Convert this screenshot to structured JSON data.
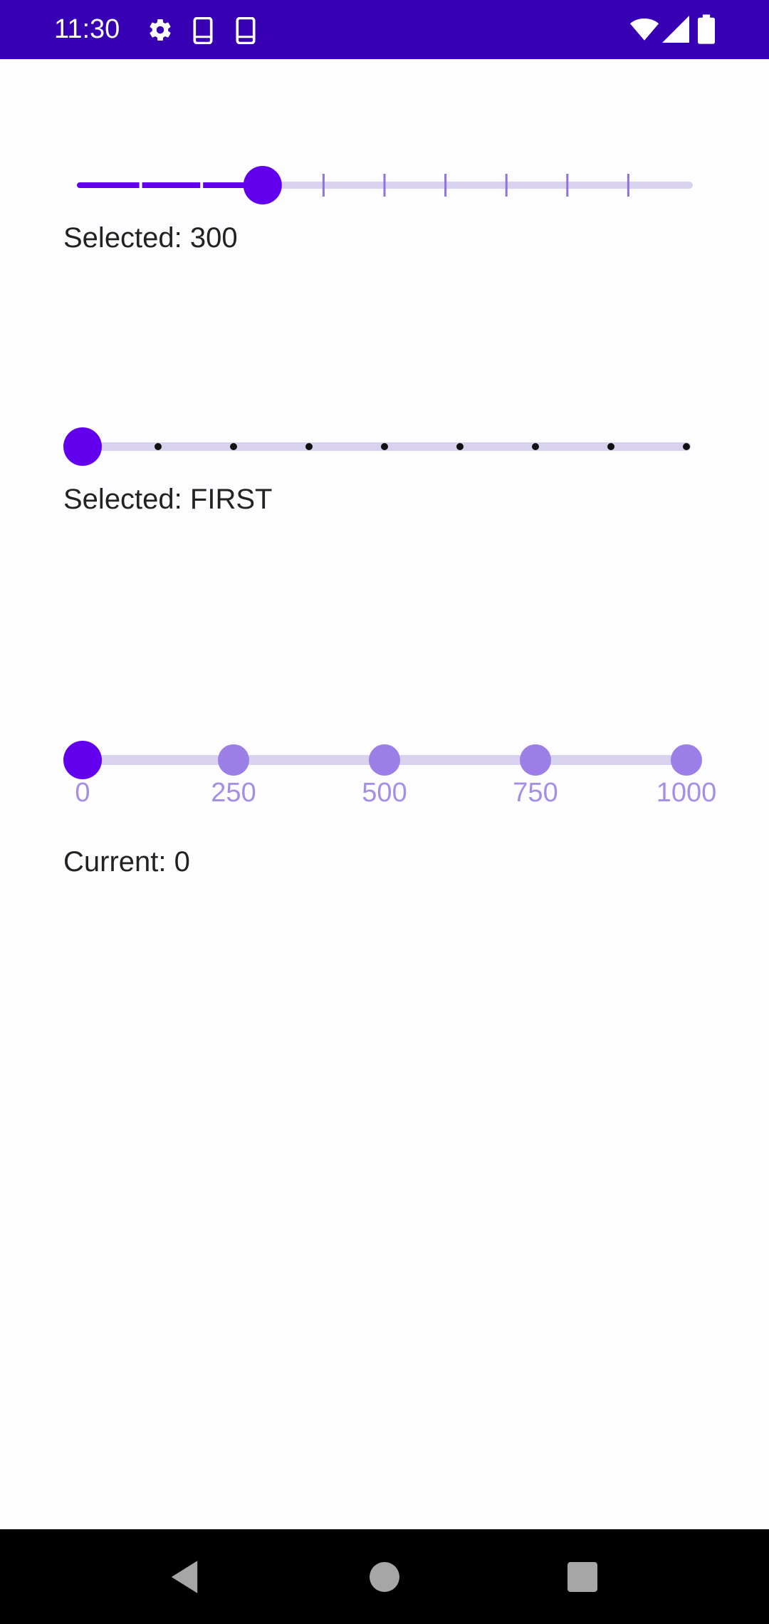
{
  "status_bar": {
    "time": "11:30",
    "icons": [
      "gear-icon",
      "phone-icon",
      "phone-icon",
      "wifi-icon",
      "signal-icon",
      "battery-icon"
    ],
    "background": "#3700b3"
  },
  "colors": {
    "accent": "#6200ee",
    "track_inactive": "#d9d2ef",
    "tick_label": "#a58ee6",
    "caption_text": "#222222"
  },
  "sliders": [
    {
      "type": "stepped",
      "min": 0,
      "max": 1000,
      "steps": 10,
      "value": 300,
      "caption": "Selected: 300"
    },
    {
      "type": "discrete-dots",
      "options_count": 9,
      "selected_index": 0,
      "caption": "Selected: FIRST"
    },
    {
      "type": "labeled-ticks",
      "ticks": [
        "0",
        "250",
        "500",
        "750",
        "1000"
      ],
      "value": 0,
      "caption": "Current: 0"
    }
  ],
  "nav_bar": {
    "icons": [
      "back-icon",
      "home-icon",
      "recents-icon"
    ]
  }
}
